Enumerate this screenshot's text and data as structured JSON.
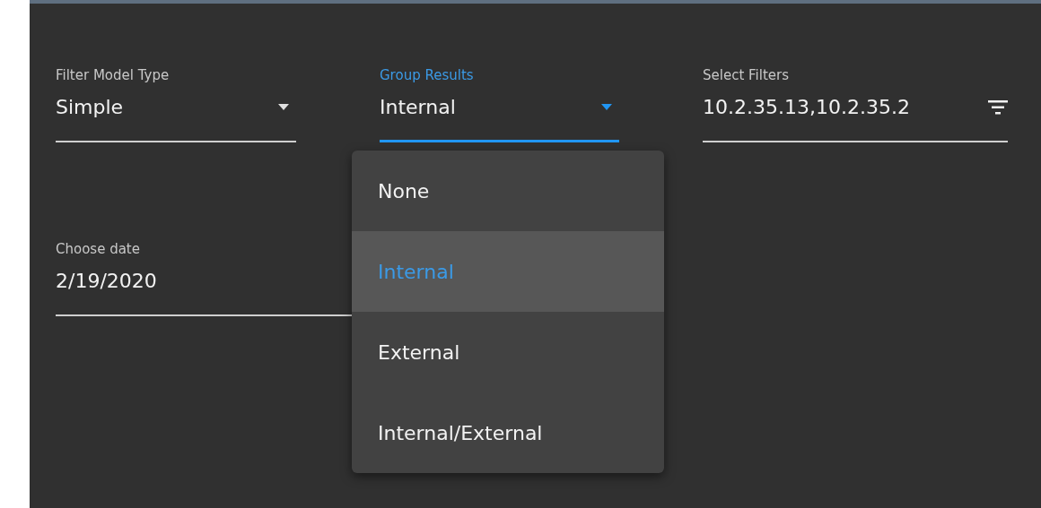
{
  "fields": [
    {
      "kind": "select",
      "label": "Filter Model Type",
      "value": "Simple",
      "focused": false
    },
    {
      "kind": "select",
      "label": "Group Results",
      "value": "Internal",
      "focused": true
    },
    {
      "kind": "filter",
      "label": "Select Filters",
      "value": "10.2.35.13,10.2.35.2",
      "focused": false
    },
    {
      "kind": "date",
      "label": "Choose date",
      "value": "2/19/2020",
      "focused": false
    }
  ],
  "menu": {
    "options": [
      {
        "label": "None",
        "selected": false
      },
      {
        "label": "Internal",
        "selected": true
      },
      {
        "label": "External",
        "selected": false
      },
      {
        "label": "Internal/External",
        "selected": false
      }
    ]
  }
}
